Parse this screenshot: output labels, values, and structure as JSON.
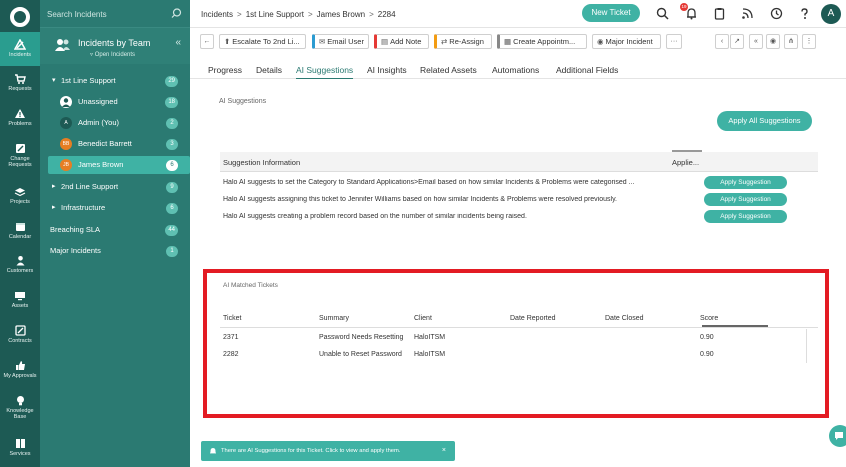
{
  "rail": {
    "items": [
      {
        "label": "Incidents",
        "icon": "warning-triangle-icon"
      },
      {
        "label": "Requests",
        "icon": "cart-icon"
      },
      {
        "label": "Problems",
        "icon": "alert-icon"
      },
      {
        "label": "Change Requests",
        "icon": "pencil-icon"
      },
      {
        "label": "Projects",
        "icon": "stack-icon"
      },
      {
        "label": "Calendar",
        "icon": "calendar-icon"
      },
      {
        "label": "Customers",
        "icon": "person-icon"
      },
      {
        "label": "Assets",
        "icon": "monitor-icon"
      },
      {
        "label": "Contracts",
        "icon": "contract-icon"
      },
      {
        "label": "My Approvals",
        "icon": "thumbs-up-icon"
      },
      {
        "label": "Knowledge Base",
        "icon": "bulb-icon"
      },
      {
        "label": "Services",
        "icon": "book-icon"
      }
    ]
  },
  "sidebar": {
    "search_placeholder": "Search Incidents",
    "team_title": "Incidents by Team",
    "team_subtitle": "Open Incidents",
    "items": [
      {
        "label": "1st Line Support",
        "count": "29",
        "caret": "▾"
      },
      {
        "label": "Unassigned",
        "count": "18",
        "initials": ""
      },
      {
        "label": "Admin (You)",
        "count": "2",
        "initials": "A"
      },
      {
        "label": "Benedict Barrett",
        "count": "3",
        "initials": "BB"
      },
      {
        "label": "James Brown",
        "count": "6",
        "initials": "JB"
      },
      {
        "label": "2nd Line Support",
        "count": "9",
        "caret": "▸"
      },
      {
        "label": "Infrastructure",
        "count": "6",
        "caret": "▸"
      },
      {
        "label": "Breaching SLA",
        "count": "44"
      },
      {
        "label": "Major Incidents",
        "count": "1"
      }
    ]
  },
  "header": {
    "breadcrumb": [
      "Incidents",
      "1st Line Support",
      "James Brown",
      "2284"
    ],
    "new_ticket": "New Ticket",
    "notification_count": "19",
    "user_initial": "A"
  },
  "toolbar": {
    "buttons": [
      {
        "label": "Escalate To 2nd Li...",
        "color": ""
      },
      {
        "label": "Email User",
        "color": "#2b9bd1"
      },
      {
        "label": "Add Note",
        "color": "#e53935"
      },
      {
        "label": "Re-Assign",
        "color": "#f39c12"
      },
      {
        "label": "Create Appointm...",
        "color": "#888888"
      },
      {
        "label": "Major Incident",
        "color": ""
      }
    ],
    "more": "···"
  },
  "tabs": [
    "Progress",
    "Details",
    "AI Suggestions",
    "AI Insights",
    "Related Assets",
    "Automations",
    "Additional Fields"
  ],
  "ai_suggestions": {
    "title": "AI Suggestions",
    "apply_all": "Apply All Suggestions",
    "col_info": "Suggestion Information",
    "col_applied": "Applie...",
    "rows": [
      {
        "text": "Halo AI suggests to set the Category to Standard Applications>Email based on how similar Incidents & Problems were categorised ...",
        "button": "Apply Suggestion"
      },
      {
        "text": "Halo AI suggests assigning this ticket to Jennifer Williams based on how similar Incidents & Problems were resolved previously.",
        "button": "Apply Suggestion"
      },
      {
        "text": "Halo AI suggests creating a problem record based on the number of similar incidents being raised.",
        "button": "Apply Suggestion"
      }
    ]
  },
  "matched_tickets": {
    "title": "AI Matched Tickets",
    "columns": [
      "Ticket",
      "Summary",
      "Client",
      "Date Reported",
      "Date Closed",
      "Score"
    ],
    "rows": [
      {
        "ticket": "2371",
        "summary": "Password Needs Resetting",
        "client": "HaloITSM",
        "reported": "",
        "closed": "",
        "score": "0.90"
      },
      {
        "ticket": "2282",
        "summary": "Unable to Reset Password",
        "client": "HaloITSM",
        "reported": "",
        "closed": "",
        "score": "0.90"
      }
    ]
  },
  "toast": {
    "message": "There are AI Suggestions for this Ticket. Click to view and apply them.",
    "close": "×"
  },
  "colors": {
    "accent": "#3fb2a4",
    "rail": "#1d5a54",
    "sidebar": "#2b7a72",
    "highlight": "#e31b23"
  }
}
